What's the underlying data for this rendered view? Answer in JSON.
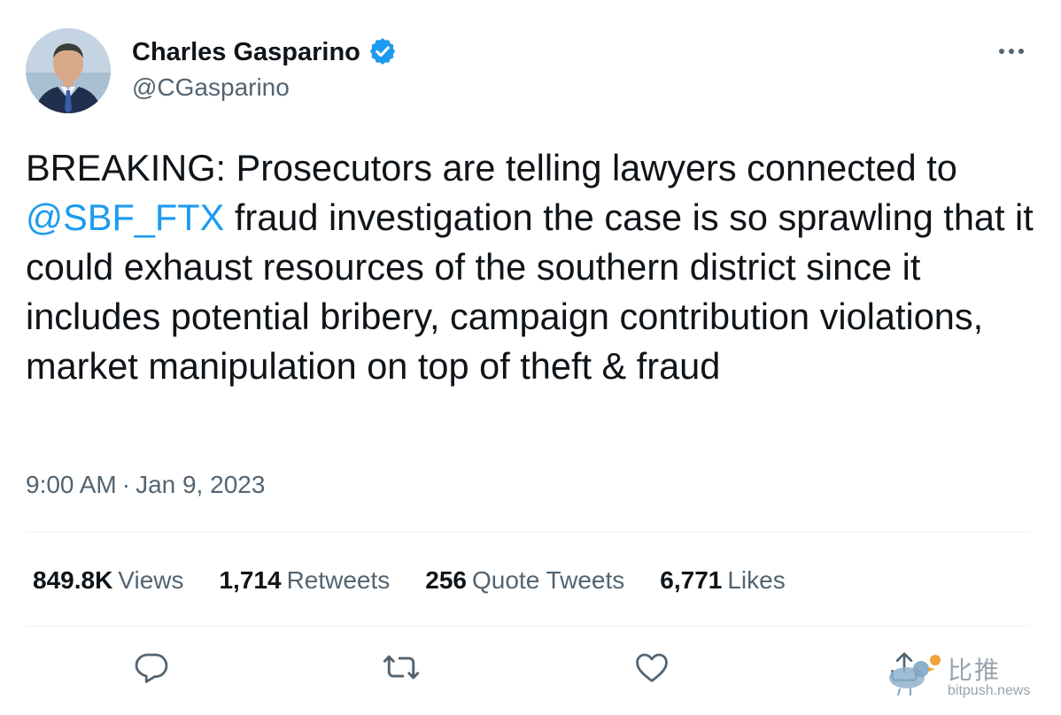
{
  "author": {
    "display_name": "Charles Gasparino",
    "handle": "@CGasparino",
    "verified": true
  },
  "tweet": {
    "text_parts": {
      "prefix": "BREAKING: Prosecutors are telling lawyers connected to ",
      "mention": "@SBF_FTX",
      "suffix": " fraud investigation the case is so sprawling that it could exhaust resources of the southern district since it includes potential bribery, campaign contribution violations, market manipulation on top of theft & fraud"
    },
    "time": "9:00 AM",
    "separator": "·",
    "date": "Jan 9, 2023"
  },
  "stats": {
    "views": {
      "value": "849.8K",
      "label": "Views"
    },
    "retweets": {
      "value": "1,714",
      "label": "Retweets"
    },
    "quotes": {
      "value": "256",
      "label": "Quote Tweets"
    },
    "likes": {
      "value": "6,771",
      "label": "Likes"
    }
  },
  "actions": {
    "reply_icon": "reply-icon",
    "retweet_icon": "retweet-icon",
    "like_icon": "heart-icon",
    "share_icon": "share-icon"
  },
  "watermark": {
    "chinese": "比推",
    "url": "bitpush.news"
  },
  "colors": {
    "accent": "#1d9bf0",
    "text": "#0f1419",
    "secondary": "#536471",
    "divider": "#eff3f4"
  }
}
